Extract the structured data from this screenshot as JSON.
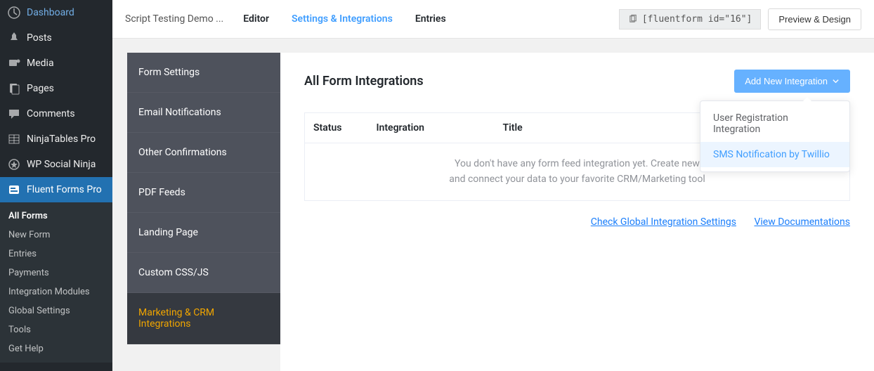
{
  "wp_menu": [
    {
      "label": "Dashboard",
      "icon": "dashboard"
    },
    {
      "label": "Posts",
      "icon": "pin"
    },
    {
      "label": "Media",
      "icon": "media"
    },
    {
      "label": "Pages",
      "icon": "pages"
    },
    {
      "label": "Comments",
      "icon": "comment"
    },
    {
      "label": "NinjaTables Pro",
      "icon": "table"
    },
    {
      "label": "WP Social Ninja",
      "icon": "star"
    },
    {
      "label": "Fluent Forms Pro",
      "icon": "form",
      "active": true
    }
  ],
  "wp_submenu": [
    {
      "label": "All Forms",
      "active": true
    },
    {
      "label": "New Form"
    },
    {
      "label": "Entries"
    },
    {
      "label": "Payments"
    },
    {
      "label": "Integration Modules"
    },
    {
      "label": "Global Settings"
    },
    {
      "label": "Tools"
    },
    {
      "label": "Get Help"
    }
  ],
  "topbar": {
    "title": "Script Testing Demo ...",
    "tabs": [
      {
        "label": "Editor"
      },
      {
        "label": "Settings & Integrations",
        "active": true
      },
      {
        "label": "Entries"
      }
    ],
    "shortcode": "[fluentform id=\"16\"]",
    "preview_btn": "Preview & Design"
  },
  "settings_tabs": [
    {
      "label": "Form Settings"
    },
    {
      "label": "Email Notifications"
    },
    {
      "label": "Other Confirmations"
    },
    {
      "label": "PDF Feeds"
    },
    {
      "label": "Landing Page"
    },
    {
      "label": "Custom CSS/JS"
    },
    {
      "label": "Marketing & CRM Integrations",
      "active": true
    }
  ],
  "content": {
    "title": "All Form Integrations",
    "add_btn": "Add New Integration",
    "dropdown": [
      {
        "label": "User Registration Integration"
      },
      {
        "label": "SMS Notification by Twillio",
        "highlighted": true
      }
    ],
    "table_headers": [
      "Status",
      "Integration",
      "Title"
    ],
    "empty_msg": "You don't have any form feed integration yet. Create new\nand connect your data to your favorite CRM/Marketing tool",
    "footer_links": [
      {
        "label": "Check Global Integration Settings"
      },
      {
        "label": "View Documentations"
      }
    ]
  }
}
